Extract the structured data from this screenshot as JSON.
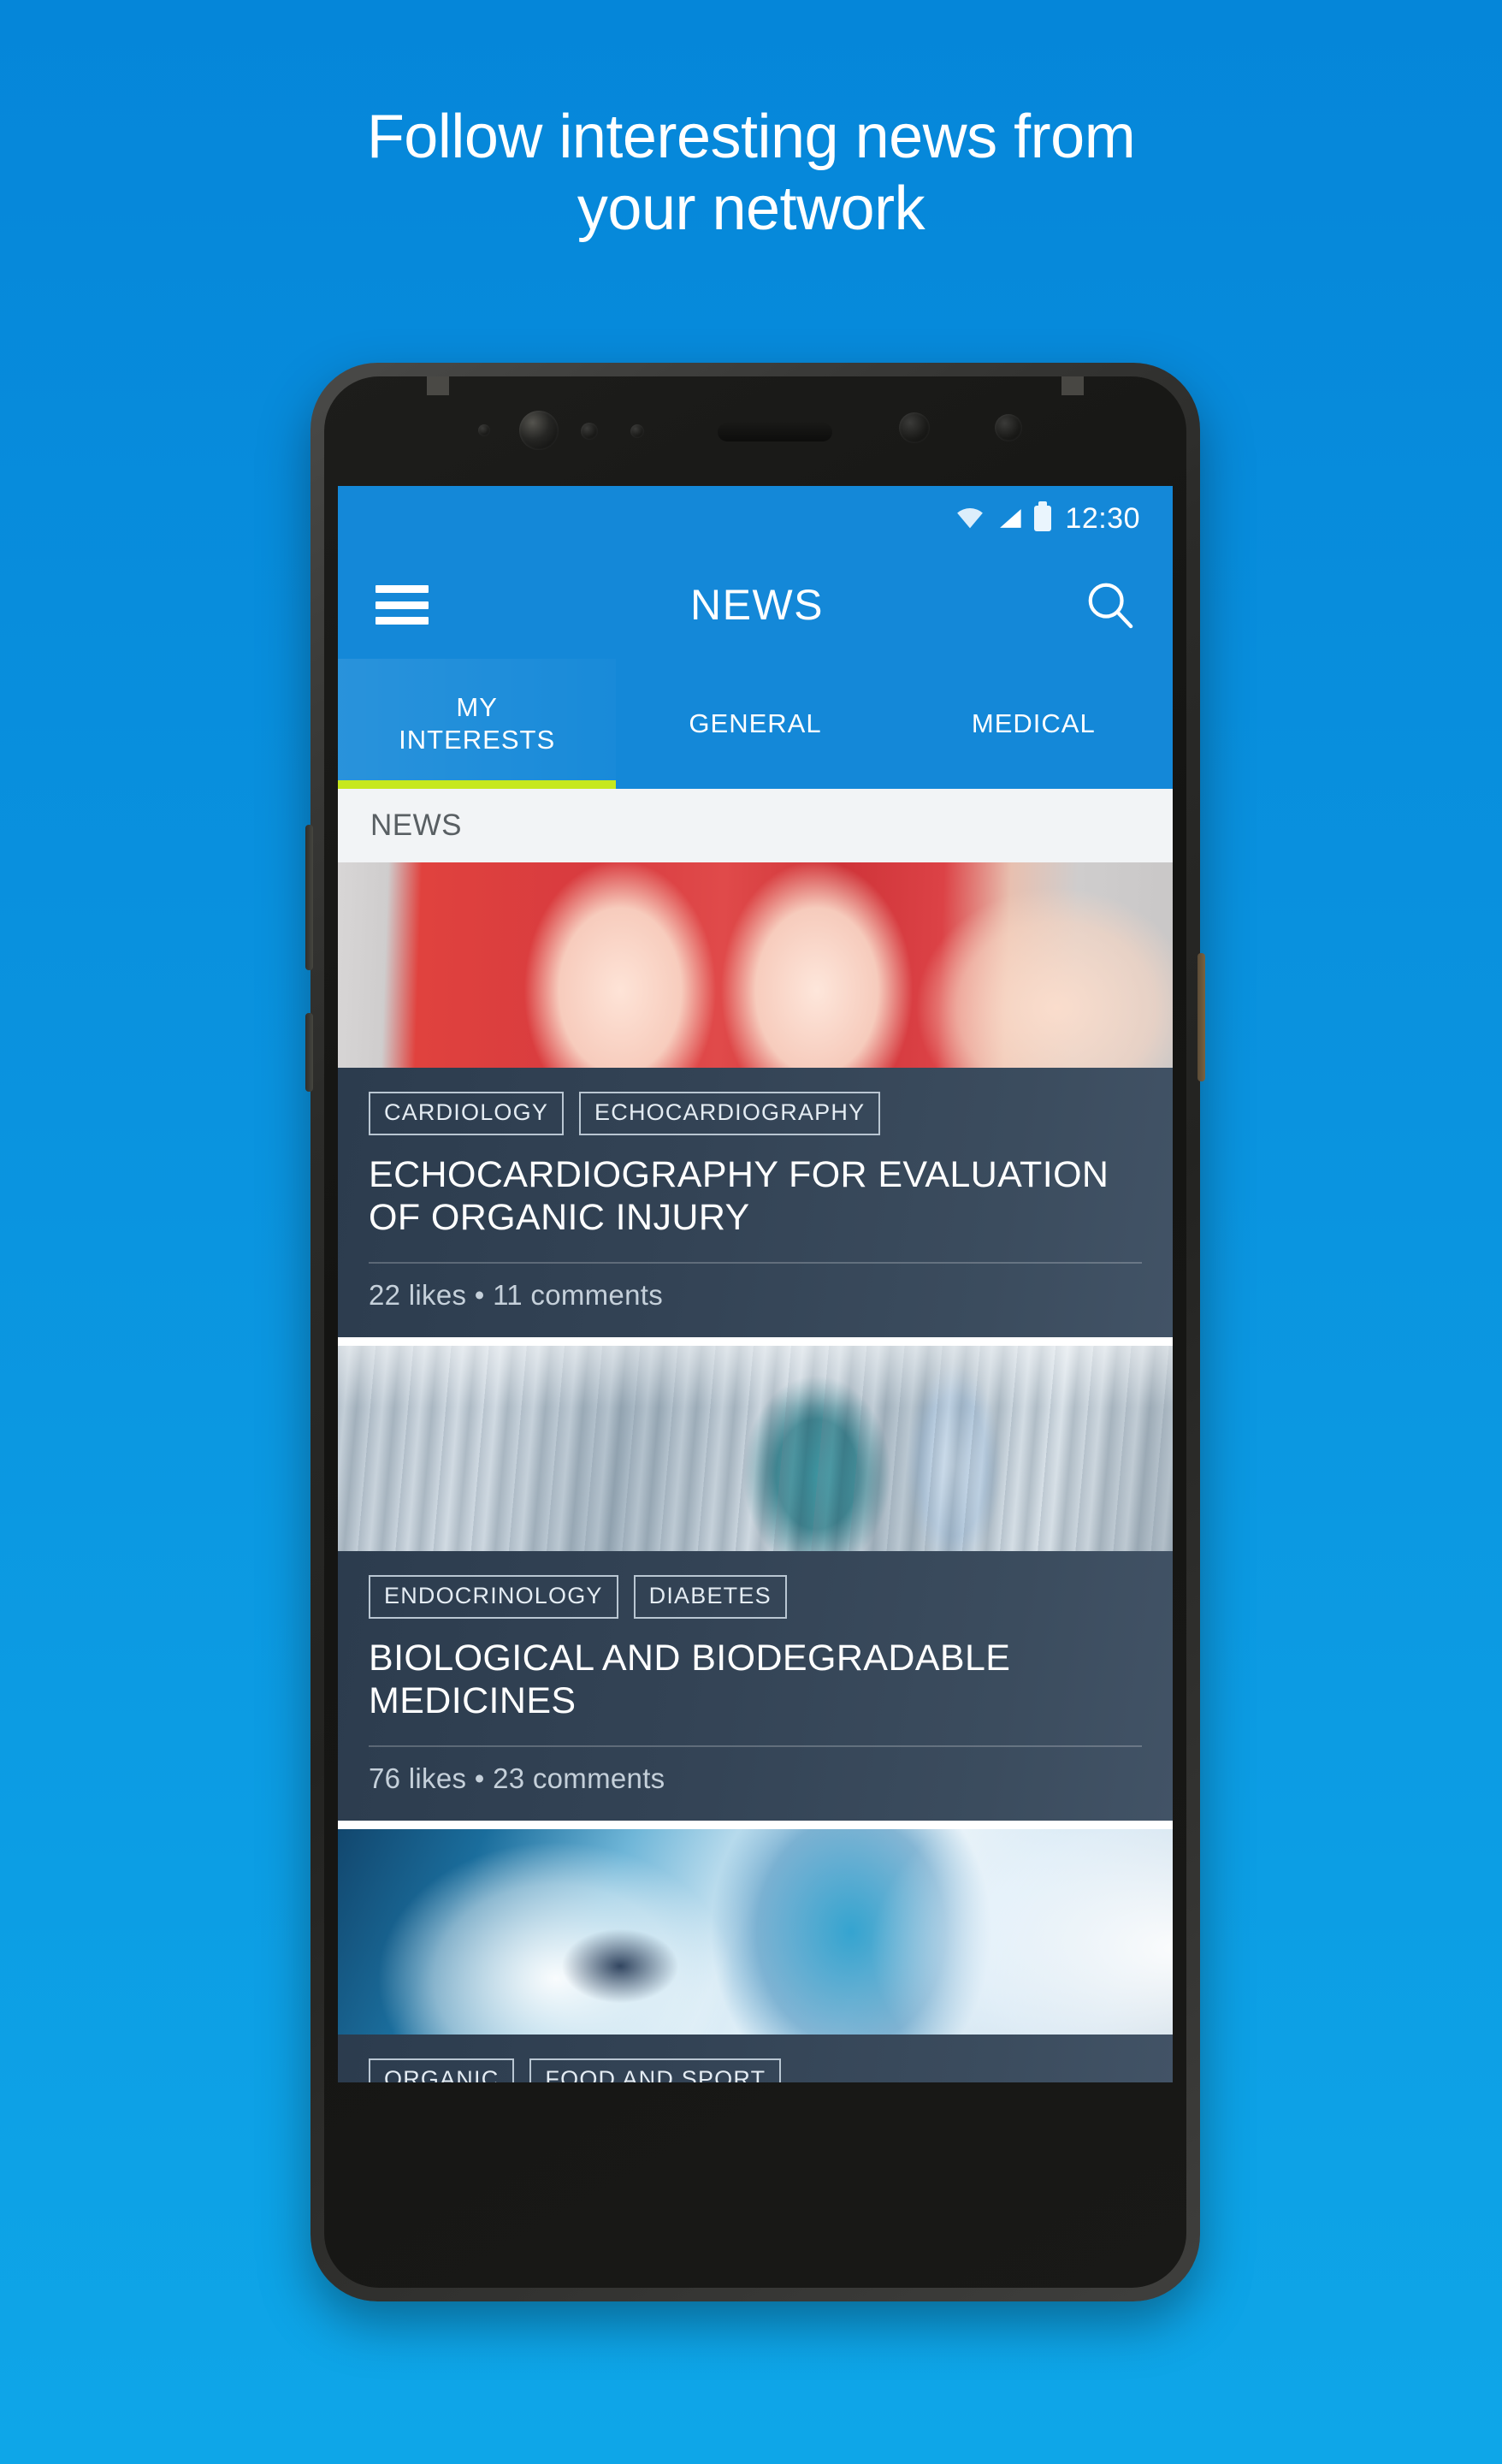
{
  "promo": {
    "headline_line1": "Follow interesting news from",
    "headline_line2": "your network"
  },
  "colors": {
    "background_top": "#0586d9",
    "background_bottom": "#0ea6e8",
    "app_bar": "#1488d8",
    "tab_indicator": "#c6e81e",
    "card_background": "#2c3c4e",
    "section_header_bg": "#f2f4f6"
  },
  "status_bar": {
    "clock": "12:30",
    "icons": [
      "wifi-icon",
      "signal-icon",
      "battery-icon"
    ]
  },
  "app_bar": {
    "menu_icon": "hamburger-menu-icon",
    "title": "NEWS",
    "search_icon": "search-icon"
  },
  "tabs": [
    {
      "label": "MY\nINTERESTS",
      "label_line1": "MY",
      "label_line2": "INTERESTS",
      "active": true
    },
    {
      "label": "GENERAL",
      "label_line1": "GENERAL",
      "label_line2": "",
      "active": false
    },
    {
      "label": "MEDICAL",
      "label_line1": "MEDICAL",
      "label_line2": "",
      "active": false
    }
  ],
  "section": {
    "title": "NEWS"
  },
  "feed": [
    {
      "image_alt": "hands-forming-heart-photo",
      "tags": [
        "CARDIOLOGY",
        "ECHOCARDIOGRAPHY"
      ],
      "title": "ECHOCARDIOGRAPHY FOR EVALUATION OF ORGANIC INJURY",
      "meta": "22 likes  •  11 comments",
      "likes": 22,
      "comments": 11
    },
    {
      "image_alt": "pharmaceutical-plant-photo",
      "tags": [
        "ENDOCRINOLOGY",
        "DIABETES"
      ],
      "title": "BIOLOGICAL AND BIODEGRADABLE MEDICINES",
      "meta": "76 likes  •  23 comments",
      "likes": 76,
      "comments": 23
    },
    {
      "image_alt": "surfer-riding-wave-photo",
      "tags": [
        "ORGANIC",
        "FOOD AND SPORT"
      ],
      "title": "",
      "meta": "",
      "likes": null,
      "comments": null
    }
  ]
}
